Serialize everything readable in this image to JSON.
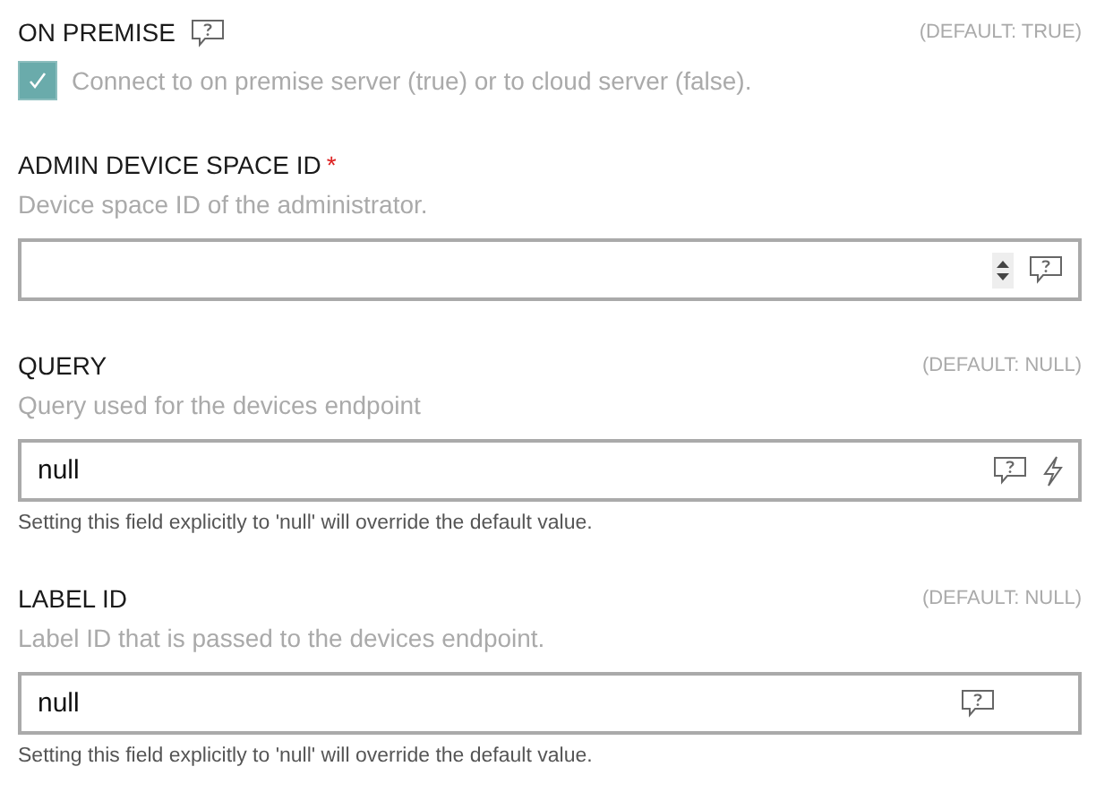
{
  "settings": [
    {
      "kind": "checkbox",
      "label": "ON PREMISE",
      "help_icon": true,
      "default": "(DEFAULT: TRUE)",
      "checked": true,
      "description": "Connect to on premise server (true) or to cloud server (false)."
    },
    {
      "kind": "number",
      "label": "ADMIN DEVICE SPACE ID",
      "required_mark": "*",
      "help_icon": false,
      "description": "Device space ID of the administrator.",
      "action_icon": false
    },
    {
      "kind": "text",
      "label": "QUERY",
      "help_icon": false,
      "default": "(DEFAULT: NULL)",
      "description": "Query used for the devices endpoint",
      "value": "null",
      "action_icon": true,
      "note": "Setting this field explicitly to 'null' will override the default value."
    },
    {
      "kind": "text",
      "label": "LABEL ID",
      "help_icon": false,
      "default": "(DEFAULT: NULL)",
      "description": "Label ID that is passed to the devices endpoint.",
      "value": "null",
      "action_icon": false,
      "note": "Setting this field explicitly to 'null' will override the default value."
    }
  ]
}
